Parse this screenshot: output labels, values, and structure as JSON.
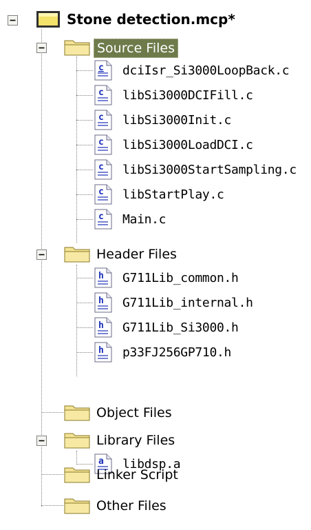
{
  "tree": {
    "root": {
      "label": "Stone detection.mcp*",
      "expanded": true
    },
    "groups": [
      {
        "label": "Source Files",
        "expanded": true,
        "selected": true,
        "files": [
          {
            "label": "dciIsr_Si3000LoopBack.c",
            "icon": "c-source-file-icon"
          },
          {
            "label": "libSi3000DCIFill.c",
            "icon": "c-source-file-icon"
          },
          {
            "label": "libSi3000Init.c",
            "icon": "c-source-file-icon"
          },
          {
            "label": "libSi3000LoadDCI.c",
            "icon": "c-source-file-icon"
          },
          {
            "label": "libSi3000StartSampling.c",
            "icon": "c-source-file-icon"
          },
          {
            "label": "libStartPlay.c",
            "icon": "c-source-file-icon"
          },
          {
            "label": "Main.c",
            "icon": "c-source-file-icon"
          }
        ]
      },
      {
        "label": "Header Files",
        "expanded": true,
        "files": [
          {
            "label": "G711Lib_common.h",
            "icon": "h-header-file-icon"
          },
          {
            "label": "G711Lib_internal.h",
            "icon": "h-header-file-icon"
          },
          {
            "label": "G711Lib_Si3000.h",
            "icon": "h-header-file-icon"
          },
          {
            "label": "p33FJ256GP710.h",
            "icon": "h-header-file-icon"
          }
        ]
      },
      {
        "label": "Object Files",
        "expanded": false,
        "files": []
      },
      {
        "label": "Library Files",
        "expanded": true,
        "files": [
          {
            "label": "libdsp.a",
            "icon": "a-library-file-icon"
          }
        ]
      },
      {
        "label": "Linker Script",
        "expanded": false,
        "files": []
      },
      {
        "label": "Other Files",
        "expanded": false,
        "files": []
      }
    ]
  },
  "colors": {
    "selection_background": "#6e7a4a",
    "selection_text": "#ffffff",
    "folder_fill": "#f4e394",
    "folder_border": "#8a7a2a",
    "file_letter": "#1a2fb8",
    "tree_lines": "#808080"
  }
}
